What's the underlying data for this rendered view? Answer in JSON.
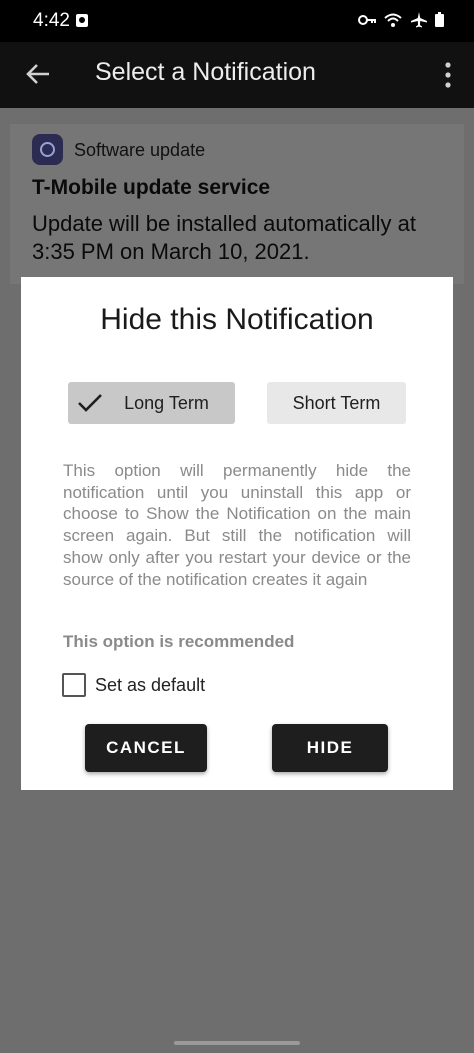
{
  "status_bar": {
    "time": "4:42",
    "icons": [
      "notification-app-icon",
      "vpn-key-icon",
      "wifi-icon",
      "airplane-icon",
      "battery-icon"
    ]
  },
  "app_bar": {
    "title": "Select a Notification",
    "icons": [
      "back-arrow-icon",
      "overflow-menu-icon"
    ]
  },
  "notification": {
    "app_name": "Software update",
    "title": "T-Mobile update service",
    "body": "Update will be installed automatically at 3:35 PM on March 10, 2021."
  },
  "dialog": {
    "title": "Hide this Notification",
    "options": {
      "long_term": "Long Term",
      "short_term": "Short Term",
      "selected": "Long Term"
    },
    "description": "This option will permanently hide the notification until you uninstall this app or choose to Show the Notification on the main screen again. But still the notification will show only after you restart your device or the source of the notification creates it again",
    "recommendation": "This option is recommended",
    "checkbox_label": "Set as default",
    "checkbox_checked": false,
    "cancel_label": "CANCEL",
    "hide_label": "HIDE"
  },
  "colors": {
    "app_bar_bg": "#111111",
    "scrim": "#6e6e6e",
    "dialog_bg": "#ffffff",
    "button_bg": "#1e1e1e",
    "selected_option_bg": "#c8c8c8"
  }
}
